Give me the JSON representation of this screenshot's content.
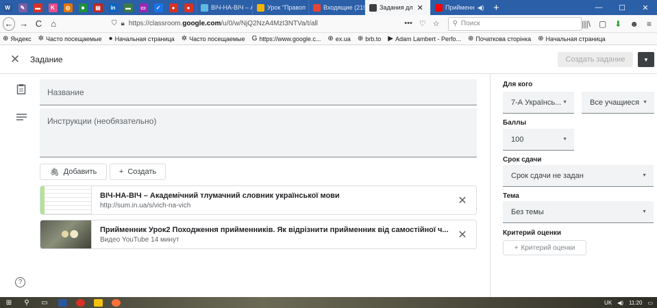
{
  "browser": {
    "pinned_tabs": [
      {
        "name": "word-pin-icon",
        "glyph": "W",
        "color": "#2b579a"
      },
      {
        "name": "tool-pin-icon",
        "glyph": "✎",
        "color": "#7b5ea7"
      },
      {
        "name": "minus-pin-icon",
        "glyph": "▬",
        "color": "#d93025"
      },
      {
        "name": "k-pin-icon",
        "glyph": "K",
        "color": "#ea4c89"
      },
      {
        "name": "circle-pin-icon",
        "glyph": "◎",
        "color": "#e37400"
      },
      {
        "name": "image-pin-icon",
        "glyph": "■",
        "color": "#1e8e3e"
      },
      {
        "name": "mail-pin-icon",
        "glyph": "▤",
        "color": "#c5221f"
      },
      {
        "name": "linkedin-pin-icon",
        "glyph": "in",
        "color": "#0a66c2"
      },
      {
        "name": "dash-pin-icon",
        "glyph": "▬",
        "color": "#3a7d44"
      },
      {
        "name": "mic-pin-icon",
        "glyph": "▭",
        "color": "#9c27b0"
      },
      {
        "name": "check-pin-icon",
        "glyph": "✓",
        "color": "#1a73e8"
      },
      {
        "name": "record-pin-icon",
        "glyph": "●",
        "color": "#d93025"
      },
      {
        "name": "record2-pin-icon",
        "glyph": "●",
        "color": "#d93025"
      }
    ],
    "tabs": [
      {
        "label": "ВІЧ-НА-ВІЧ – А",
        "fav_color": "#5fb8e0"
      },
      {
        "label": "Урок \"Правоп",
        "fav_color": "#f4b400"
      },
      {
        "label": "Входящие (219",
        "fav_color": "#ea4335"
      },
      {
        "label": "Задания дл",
        "fav_color": "#3c4043"
      },
      {
        "label": "Прийменн",
        "fav_color": "#ff0000"
      }
    ],
    "active_tab_close": "✕",
    "sound_icon": "◀)",
    "new_tab": "+",
    "window_controls": [
      "—",
      "☐",
      "✕"
    ],
    "nav": {
      "back": "←",
      "forward": "→",
      "reload": "C",
      "home": "⌂"
    },
    "url": {
      "prefix": "https://classroom.",
      "domain": "google.com",
      "path": "/u/0/w/NjQ2NzA4MzI3NTVa/t/all"
    },
    "url_actions": [
      "•••",
      "♡",
      "☆"
    ],
    "search_placeholder": "Поиск",
    "right_icons": [
      "|||\\",
      "▢",
      "⬇",
      "☻",
      "≡"
    ]
  },
  "bookmarks": [
    {
      "icon": "⊕",
      "label": "Яндекс"
    },
    {
      "icon": "✲",
      "label": "Часто посещаемые"
    },
    {
      "icon": "●",
      "label": "Начальная страница"
    },
    {
      "icon": "✲",
      "label": "Часто посещаемые"
    },
    {
      "icon": "G",
      "label": "https://www.google.c..."
    },
    {
      "icon": "⊕",
      "label": "ex.ua"
    },
    {
      "icon": "⊕",
      "label": "brb.to"
    },
    {
      "icon": "▶",
      "label": "Adam Lambert - Perfo..."
    },
    {
      "icon": "⊕",
      "label": "Початкова сторінка"
    },
    {
      "icon": "⊕",
      "label": "Начальная страница"
    }
  ],
  "header": {
    "close": "✕",
    "title": "Задание",
    "create_label": "Создать задание",
    "dropdown": "▼"
  },
  "form": {
    "title_placeholder": "Название",
    "instructions_placeholder": "Инструкции (необязательно)",
    "add_label": "Добавить",
    "create_label": "Создать",
    "attachments": [
      {
        "title": "ВІЧ-НА-ВІЧ – Академічний тлумачний словник української мови",
        "subtitle": "http://sum.in.ua/s/vich-na-vich"
      },
      {
        "title": "Прийменник Урок2 Походження прийменників. Як відрізнити прийменник від самостійної ч...",
        "subtitle": "Видео YouTube  14 минут"
      }
    ],
    "help": "?"
  },
  "side": {
    "for_whom_label": "Для кого",
    "class_value": "7-А Українсь...",
    "students_value": "Все учащиеся",
    "points_label": "Баллы",
    "points_value": "100",
    "due_label": "Срок сдачи",
    "due_value": "Срок сдачи не задан",
    "topic_label": "Тема",
    "topic_value": "Без темы",
    "rubric_label": "Критерий оценки",
    "rubric_button": "Критерий оценки",
    "arrow": "▼"
  },
  "taskbar": {
    "lang": "UK",
    "time": "11:20"
  },
  "colors": {
    "tabstrip": "#2b5fa8",
    "accent": "#1a73e8"
  }
}
